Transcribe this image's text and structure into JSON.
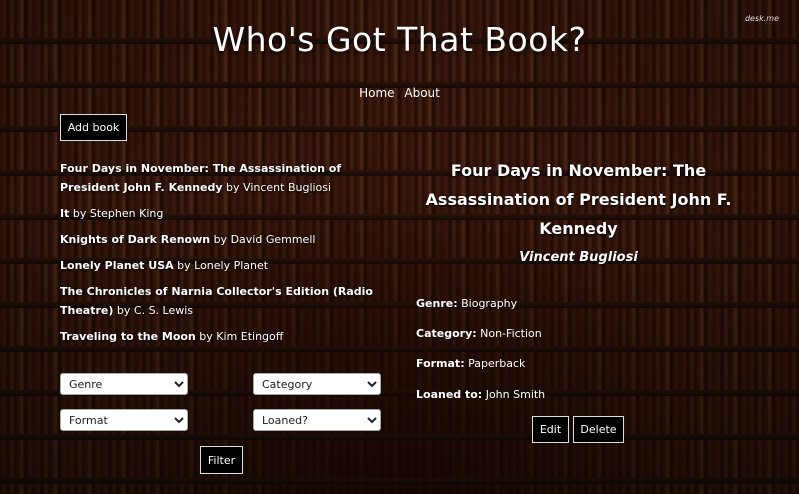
{
  "header": {
    "title": "Who's Got That Book?",
    "watermark": "desk.me"
  },
  "nav": {
    "home": "Home",
    "about": "About"
  },
  "actions": {
    "add_book": "Add book",
    "edit": "Edit",
    "delete": "Delete",
    "filter": "Filter"
  },
  "books": [
    {
      "title": "Four Days in November: The Assassination of President John F. Kennedy",
      "by": " by ",
      "author": "Vincent Bugliosi"
    },
    {
      "title": "It",
      "by": " by ",
      "author": "Stephen King"
    },
    {
      "title": "Knights of Dark Renown",
      "by": " by ",
      "author": "David Gemmell"
    },
    {
      "title": "Lonely Planet USA",
      "by": " by ",
      "author": "Lonely Planet"
    },
    {
      "title": "The Chronicles of Narnia Collector's Edition (Radio Theatre)",
      "by": " by ",
      "author": "C. S. Lewis"
    },
    {
      "title": "Traveling to the Moon",
      "by": " by ",
      "author": "Kim Etingoff"
    }
  ],
  "selected": {
    "title": "Four Days in November: The Assassination of President John F. Kennedy",
    "author": "Vincent Bugliosi",
    "genre_label": "Genre:",
    "genre": "Biography",
    "category_label": "Category:",
    "category": "Non-Fiction",
    "format_label": "Format:",
    "format": "Paperback",
    "loaned_label": "Loaned to:",
    "loaned": "John Smith"
  },
  "filters": {
    "genre": "Genre",
    "category": "Category",
    "format": "Format",
    "loaned": "Loaned?"
  }
}
